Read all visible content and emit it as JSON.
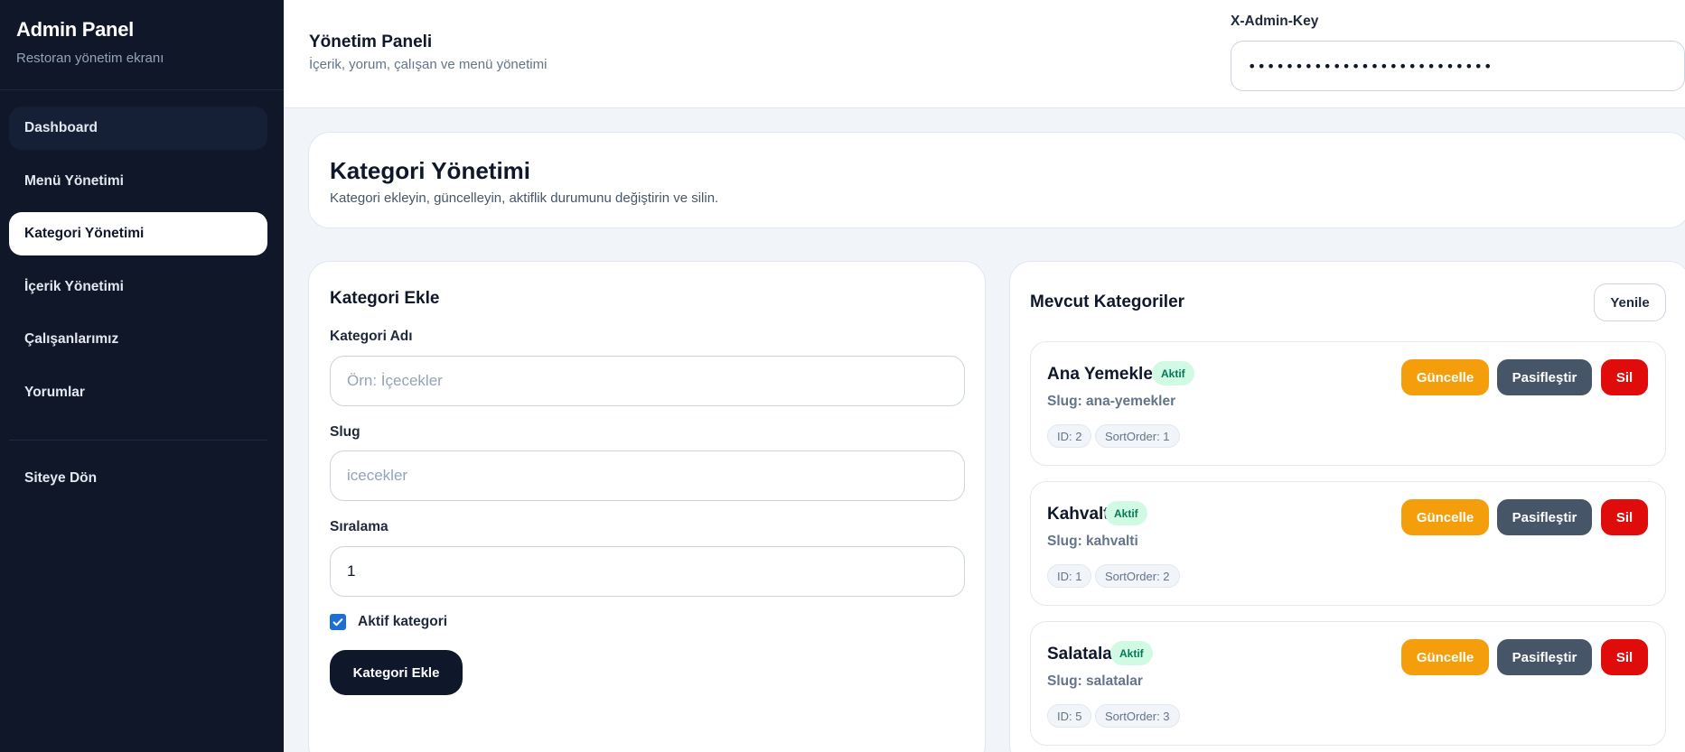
{
  "sidebar": {
    "title": "Admin Panel",
    "subtitle": "Restoran yönetim ekranı",
    "items": [
      {
        "label": "Dashboard"
      },
      {
        "label": "Menü Yönetimi"
      },
      {
        "label": "Kategori Yönetimi"
      },
      {
        "label": "İçerik Yönetimi"
      },
      {
        "label": "Çalışanlarımız"
      },
      {
        "label": "Yorumlar"
      }
    ],
    "back_label": "Siteye Dön"
  },
  "header": {
    "title": "Yönetim Paneli",
    "subtitle": "İçerik, yorum, çalışan ve menü yönetimi",
    "key_label": "X-Admin-Key",
    "key_value": "••••••••••••••••••••••••••"
  },
  "page": {
    "title": "Kategori Yönetimi",
    "subtitle": "Kategori ekleyin, güncelleyin, aktiflik durumunu değiştirin ve silin."
  },
  "form": {
    "title": "Kategori Ekle",
    "name_label": "Kategori Adı",
    "name_placeholder": "Örn: İçecekler",
    "slug_label": "Slug",
    "slug_placeholder": "icecekler",
    "order_label": "Sıralama",
    "order_value": "1",
    "active_label": "Aktif kategori",
    "active_checked": true,
    "submit_label": "Kategori Ekle"
  },
  "list": {
    "title": "Mevcut Kategoriler",
    "refresh_label": "Yenile",
    "update_label": "Güncelle",
    "deactivate_label": "Pasifleştir",
    "delete_label": "Sil",
    "items": [
      {
        "name": "Ana Yemekler",
        "status": "Aktif",
        "slug": "Slug: ana-yemekler",
        "id": "ID: 2",
        "sort": "SortOrder: 1"
      },
      {
        "name": "Kahvaltı",
        "status": "Aktif",
        "slug": "Slug: kahvalti",
        "id": "ID: 1",
        "sort": "SortOrder: 2"
      },
      {
        "name": "Salatalar",
        "status": "Aktif",
        "slug": "Slug: salatalar",
        "id": "ID: 5",
        "sort": "SortOrder: 3"
      }
    ]
  },
  "colors": {
    "sidebar_bg": "#0f1729",
    "accent_update": "#f59e0b",
    "accent_deactivate": "#475569",
    "accent_delete": "#e00b0b",
    "badge_active": "#d1fae5"
  }
}
